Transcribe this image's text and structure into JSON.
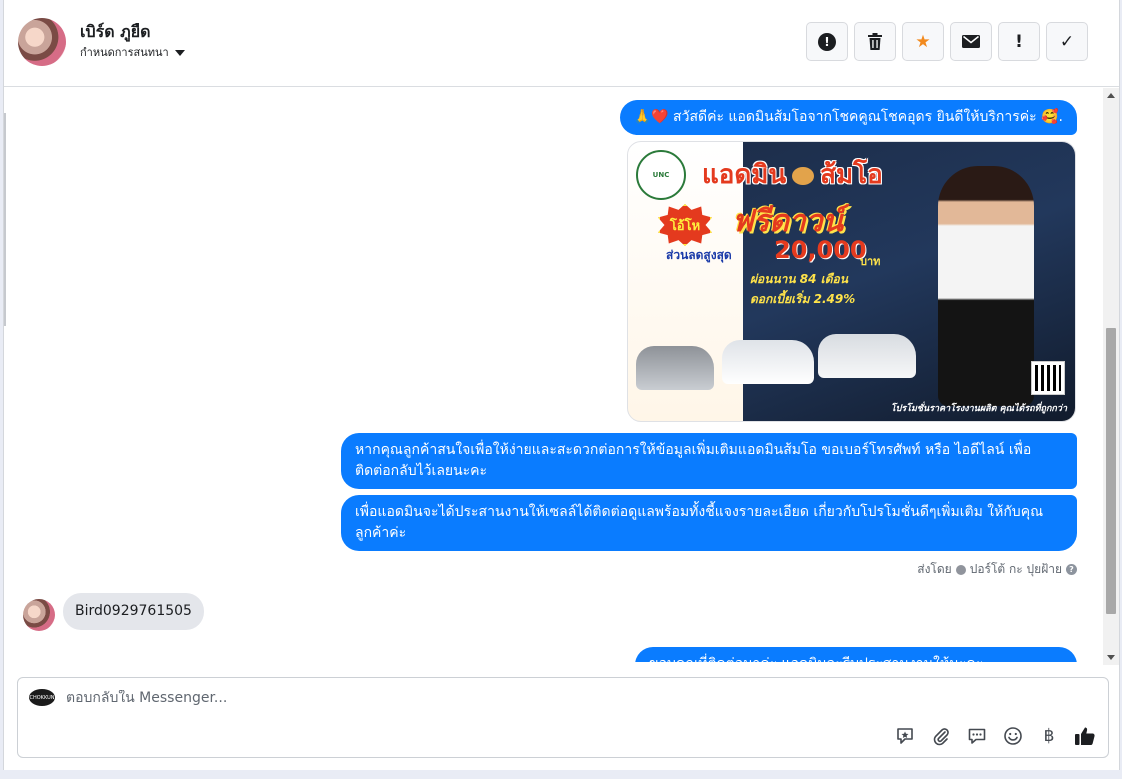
{
  "header": {
    "contact_name": "เบิร์ด ภูยืด",
    "conversation_settings_label": "กำหนดการสนทนา",
    "toolbar": [
      {
        "name": "spam-button",
        "icon": "alert-circle-icon",
        "glyph": "!"
      },
      {
        "name": "delete-button",
        "icon": "trash-icon",
        "glyph": "🗑"
      },
      {
        "name": "star-button",
        "icon": "star-icon",
        "glyph": "★"
      },
      {
        "name": "mark-unread-button",
        "icon": "envelope-icon",
        "glyph": "✉"
      },
      {
        "name": "follow-up-button",
        "icon": "exclamation-icon",
        "glyph": "!"
      },
      {
        "name": "mark-done-button",
        "icon": "checkmark-icon",
        "glyph": "✓"
      }
    ]
  },
  "thread": {
    "messages": {
      "greeting": "🙏❤️ สวัสดีค่ะ แอดมินส้มโอจากโชคคูณโชคอุดร ยินดีให้บริการค่ะ 🥰.",
      "contact_request": "หากคุณลูกค้าสนใจเพื่อให้ง่ายและสะดวกต่อการให้ข้อมูลเพิ่มเติมแอดมินส้มโอ ขอเบอร์โทรศัพท์ หรือ ไอดีไลน์ เพื่อติดต่อกลับไว้เลยนะคะ",
      "coordination": "เพื่อแอดมินจะได้ประสานงานให้เซลล์ได้ติดต่อดูแลพร้อมทั้งชี้แจงรายละเอียด เกี่ยวกับโปรโมชั่นดีๆเพิ่มเติม ให้กับคุณลูกค้าค่ะ",
      "incoming": "Bird0929761505",
      "partial": "ขอบคุณที่ติดต่อมาค่ะ แอดมินจะรีบประสานงานให้นะคะ"
    },
    "sent_by": {
      "prefix": "ส่งโดย",
      "sender": "ปอร์โต้ กะ ปุยฝ้าย"
    },
    "promo_image": {
      "logo_text": "UNC",
      "title_left": "แอดมิน",
      "title_right": "ส้มโอ",
      "badge": "โอ้โห",
      "headline": "ฟรีดาวน์",
      "discount_label": "ส่วนลดสูงสุด",
      "amount": "20,000",
      "unit": "บาท",
      "installment": "ผ่อนนาน 84 เดือน",
      "interest": "ดอกเบี้ยเริ่ม 2.49%",
      "footer": "โปรโมชั่นราคาโรงงานผลิต คุณได้รถที่ถูกกว่า"
    }
  },
  "composer": {
    "placeholder": "ตอบกลับใน Messenger...",
    "value": "",
    "page_avatar_text": "CHOKKUN",
    "tools": [
      {
        "name": "saved-reply-button",
        "icon": "saved-reply-icon",
        "glyph": "✎"
      },
      {
        "name": "attach-button",
        "icon": "paperclip-icon",
        "glyph": "📎"
      },
      {
        "name": "quick-reply-button",
        "icon": "chat-bubble-icon",
        "glyph": "💬"
      },
      {
        "name": "emoji-button",
        "icon": "smiley-icon",
        "glyph": "☺"
      },
      {
        "name": "payment-button",
        "icon": "baht-icon",
        "glyph": "฿"
      },
      {
        "name": "like-button",
        "icon": "thumbs-up-icon",
        "glyph": "👍"
      }
    ]
  },
  "colors": {
    "outgoing_bubble": "#0a7cff",
    "incoming_bubble": "#e4e6eb",
    "star": "#f28a1e"
  }
}
